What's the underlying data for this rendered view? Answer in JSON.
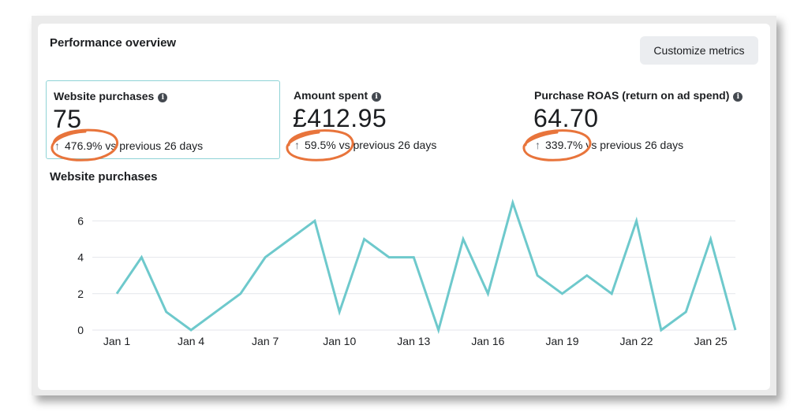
{
  "card": {
    "title": "Performance overview",
    "customize_label": "Customize metrics"
  },
  "metrics": [
    {
      "label": "Website purchases",
      "value": "75",
      "change": "476.9%",
      "suffix": "vs previous 26 days",
      "selected": true
    },
    {
      "label": "Amount spent",
      "value": "£412.95",
      "change": "59.5%",
      "suffix": "vs previous 26 days",
      "selected": false
    },
    {
      "label": "Purchase ROAS (return on ad spend)",
      "value": "64.70",
      "change": "339.7%",
      "suffix": "vs previous 26 days",
      "selected": false
    }
  ],
  "icons": {
    "info": "info-icon",
    "trend": "arrow-up-icon"
  },
  "colors": {
    "line": "#6ec9cc",
    "highlight_circle": "#e8743b",
    "selected_border": "#8fd3d6",
    "gridline": "#e4e6eb"
  },
  "chart_data": {
    "type": "line",
    "title": "Website purchases",
    "x": [
      1,
      2,
      3,
      4,
      5,
      6,
      7,
      8,
      9,
      10,
      11,
      12,
      13,
      14,
      15,
      16,
      17,
      18,
      19,
      20,
      21,
      22,
      23,
      24,
      25,
      26
    ],
    "values": [
      2,
      4,
      1,
      0,
      1,
      2,
      4,
      5,
      6,
      1,
      5,
      4,
      4,
      0,
      5,
      2,
      7,
      3,
      2,
      3,
      2,
      6,
      0,
      1,
      5,
      0
    ],
    "x_tick_values": [
      1,
      4,
      7,
      10,
      13,
      16,
      19,
      22,
      25
    ],
    "x_tick_labels": [
      "Jan 1",
      "Jan 4",
      "Jan 7",
      "Jan 10",
      "Jan 13",
      "Jan 16",
      "Jan 19",
      "Jan 22",
      "Jan 25"
    ],
    "y_ticks": [
      0,
      2,
      4,
      6
    ],
    "ylim": [
      0,
      7
    ],
    "grid": true,
    "legend": "none"
  }
}
